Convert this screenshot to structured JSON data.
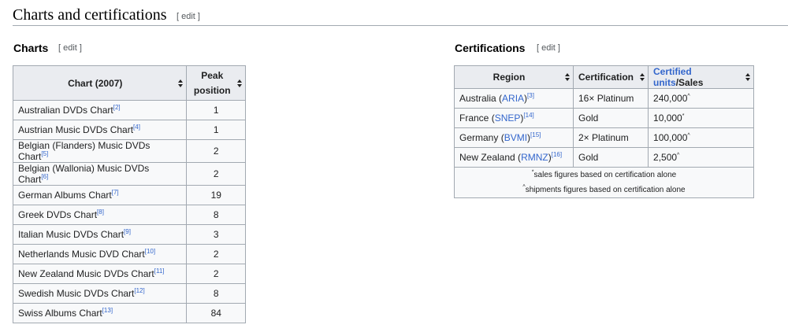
{
  "heading": {
    "title": "Charts and certifications",
    "edit": "[ edit ]"
  },
  "charts": {
    "heading": "Charts",
    "edit": "[ edit ]",
    "columns": [
      "Chart (2007)",
      "Peak position"
    ],
    "rows": [
      {
        "chart": "Australian DVDs Chart",
        "ref": "[2]",
        "peak": "1"
      },
      {
        "chart": "Austrian Music DVDs Chart",
        "ref": "[4]",
        "peak": "1"
      },
      {
        "chart": "Belgian (Flanders) Music DVDs Chart",
        "ref": "[5]",
        "peak": "2"
      },
      {
        "chart": "Belgian (Wallonia) Music DVDs Chart",
        "ref": "[6]",
        "peak": "2"
      },
      {
        "chart": "German Albums Chart",
        "ref": "[7]",
        "peak": "19"
      },
      {
        "chart": "Greek DVDs Chart",
        "ref": "[8]",
        "peak": "8"
      },
      {
        "chart": "Italian Music DVDs Chart",
        "ref": "[9]",
        "peak": "3"
      },
      {
        "chart": "Netherlands Music DVD Chart",
        "ref": "[10]",
        "peak": "2"
      },
      {
        "chart": "New Zealand Music DVDs Chart",
        "ref": "[11]",
        "peak": "2"
      },
      {
        "chart": "Swedish Music DVDs Chart",
        "ref": "[12]",
        "peak": "8"
      },
      {
        "chart": "Swiss Albums Chart",
        "ref": "[13]",
        "peak": "84"
      }
    ]
  },
  "certifications": {
    "heading": "Certifications",
    "edit": "[ edit ]",
    "columns": {
      "region": "Region",
      "certification": "Certification",
      "units_link": "Certified units",
      "units_rest": "/Sales"
    },
    "rows": [
      {
        "country": "Australia",
        "org": "ARIA",
        "ref": "[3]",
        "cert": "16× Platinum",
        "units": "240,000",
        "mark": "^"
      },
      {
        "country": "France",
        "org": "SNEP",
        "ref": "[14]",
        "cert": "Gold",
        "units": "10,000",
        "mark": "*"
      },
      {
        "country": "Germany",
        "org": "BVMI",
        "ref": "[15]",
        "cert": "2× Platinum",
        "units": "100,000",
        "mark": "^"
      },
      {
        "country": "New Zealand",
        "org": "RMNZ",
        "ref": "[16]",
        "cert": "Gold",
        "units": "2,500",
        "mark": "^"
      }
    ],
    "notes": [
      {
        "mark": "*",
        "text": "sales figures based on certification alone"
      },
      {
        "mark": "^",
        "text": "shipments figures based on certification alone"
      }
    ]
  }
}
